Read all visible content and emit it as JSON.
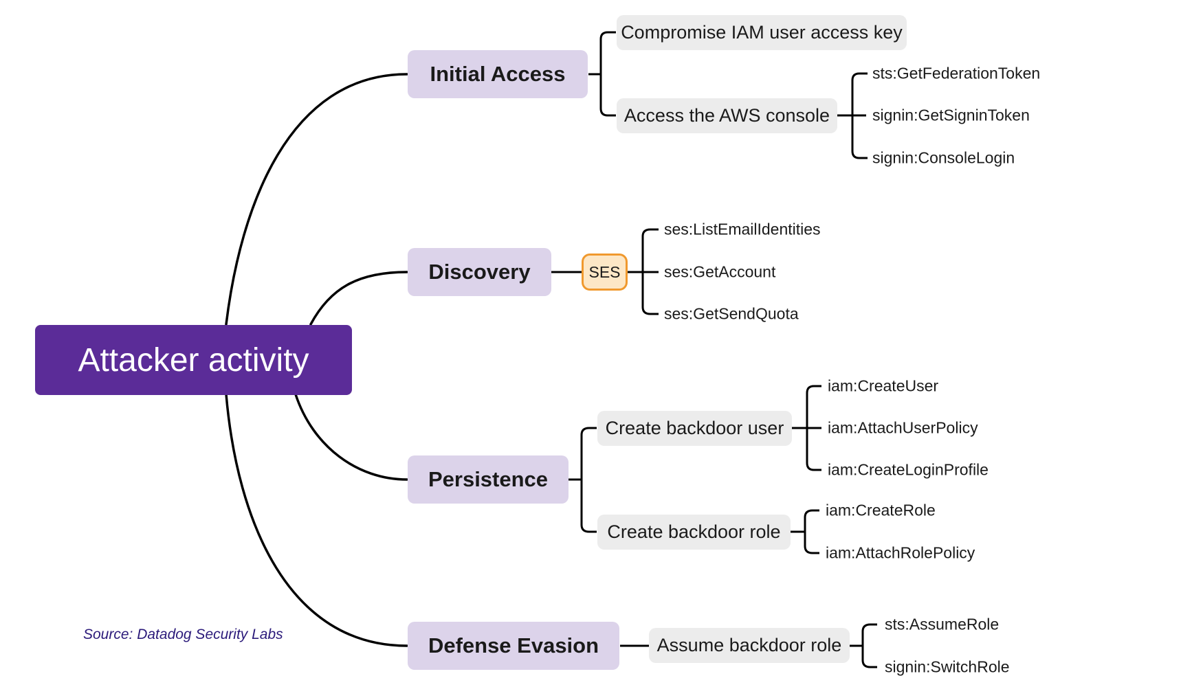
{
  "root": {
    "label": "Attacker activity",
    "color": "#5b2c98"
  },
  "source": "Source: Datadog Security Labs",
  "colors": {
    "tactic_bg": "#dcd3ea",
    "technique_bg": "#ececec",
    "service_bg": "#fde7c6",
    "service_border": "#f0992e",
    "line": "#000000"
  },
  "tactics": [
    {
      "label": "Initial Access",
      "techniques": [
        {
          "label": "Compromise IAM user access key",
          "actions": []
        },
        {
          "label": "Access the AWS console",
          "actions": [
            "sts:GetFederationToken",
            "signin:GetSigninToken",
            "signin:ConsoleLogin"
          ]
        }
      ]
    },
    {
      "label": "Discovery",
      "service": "SES",
      "actions": [
        "ses:ListEmailIdentities",
        "ses:GetAccount",
        "ses:GetSendQuota"
      ]
    },
    {
      "label": "Persistence",
      "techniques": [
        {
          "label": "Create backdoor user",
          "actions": [
            "iam:CreateUser",
            "iam:AttachUserPolicy",
            "iam:CreateLoginProfile"
          ]
        },
        {
          "label": "Create backdoor role",
          "actions": [
            "iam:CreateRole",
            "iam:AttachRolePolicy"
          ]
        }
      ]
    },
    {
      "label": "Defense Evasion",
      "techniques": [
        {
          "label": "Assume backdoor role",
          "actions": [
            "sts:AssumeRole",
            "signin:SwitchRole"
          ]
        }
      ]
    }
  ]
}
